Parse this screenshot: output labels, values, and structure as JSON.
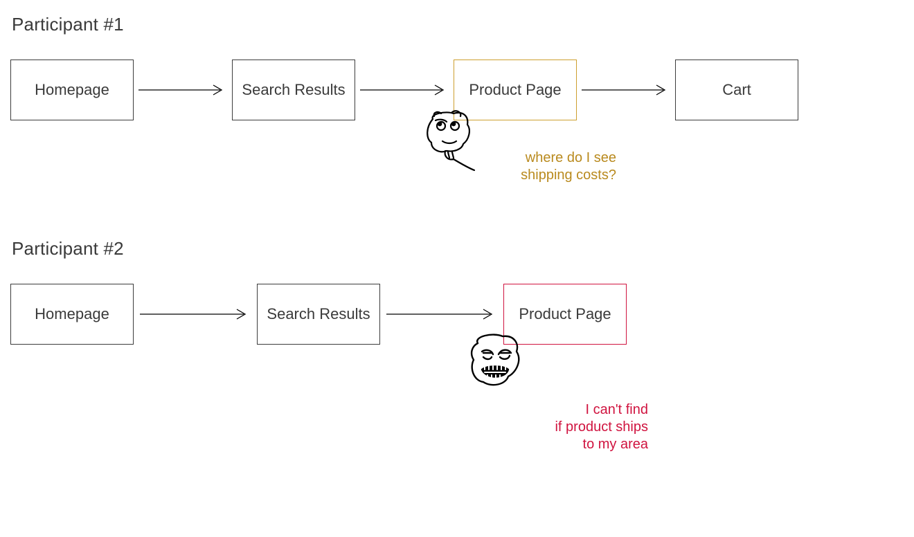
{
  "participants": [
    {
      "title": "Participant #1",
      "flow": [
        "Homepage",
        "Search Results",
        "Product Page",
        "Cart"
      ],
      "highlight_index": 2,
      "highlight_color": "yellow",
      "reaction": "confused",
      "caption": "where do I see\nshipping costs?"
    },
    {
      "title": "Participant #2",
      "flow": [
        "Homepage",
        "Search Results",
        "Product Page"
      ],
      "highlight_index": 2,
      "highlight_color": "red",
      "reaction": "frustrated",
      "caption": "I can't find\nif product ships\nto my area"
    }
  ],
  "colors": {
    "text": "#3a3a3a",
    "border": "#3b3b3b",
    "yellow": "#cd9f2e",
    "yellow_text": "#b98a1e",
    "red": "#d0133f"
  }
}
